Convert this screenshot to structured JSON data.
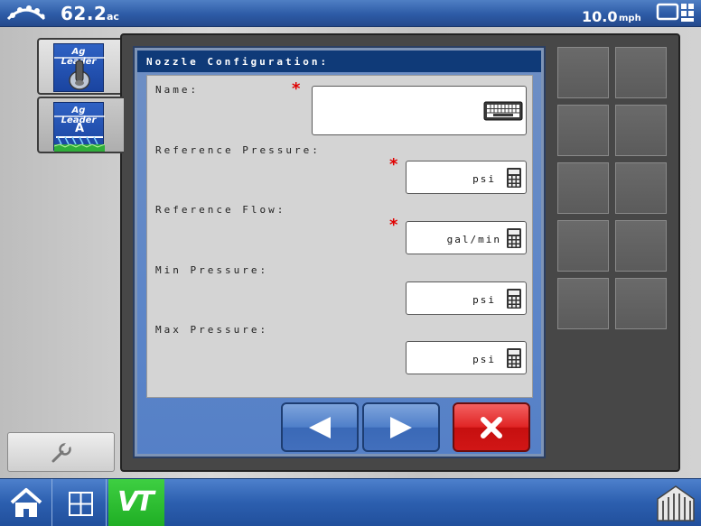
{
  "status_bar": {
    "area_value": "62.2",
    "area_unit": "ac",
    "speed_value": "10.0",
    "speed_unit": "mph",
    "gps_icon": "satellite-icon",
    "display_icon": "display-settings-icon"
  },
  "tabs": [
    {
      "brand": "Ag Leader",
      "icon": "joystick-icon"
    },
    {
      "brand": "Ag Leader",
      "icon": "sprayer-icon"
    }
  ],
  "dialog": {
    "title": "Nozzle Configuration:",
    "fields": [
      {
        "label": "Name:",
        "required": true,
        "value": "",
        "unit": "",
        "icon": "keyboard-icon"
      },
      {
        "label": "Reference Pressure:",
        "required": true,
        "value": "",
        "unit": "psi",
        "icon": "calculator-icon"
      },
      {
        "label": "Reference Flow:",
        "required": true,
        "value": "",
        "unit": "gal/min",
        "icon": "calculator-icon"
      },
      {
        "label": "Min Pressure:",
        "required": false,
        "value": "",
        "unit": "psi",
        "icon": "calculator-icon"
      },
      {
        "label": "Max Pressure:",
        "required": false,
        "value": "",
        "unit": "psi",
        "icon": "calculator-icon"
      }
    ],
    "required_marker": "*"
  },
  "taskbar": {
    "vt_label": "VT"
  },
  "colors": {
    "header_blue": "#0f3a78",
    "required_red": "#e00000",
    "vt_green": "#1fae24",
    "cancel_red": "#e02424"
  }
}
